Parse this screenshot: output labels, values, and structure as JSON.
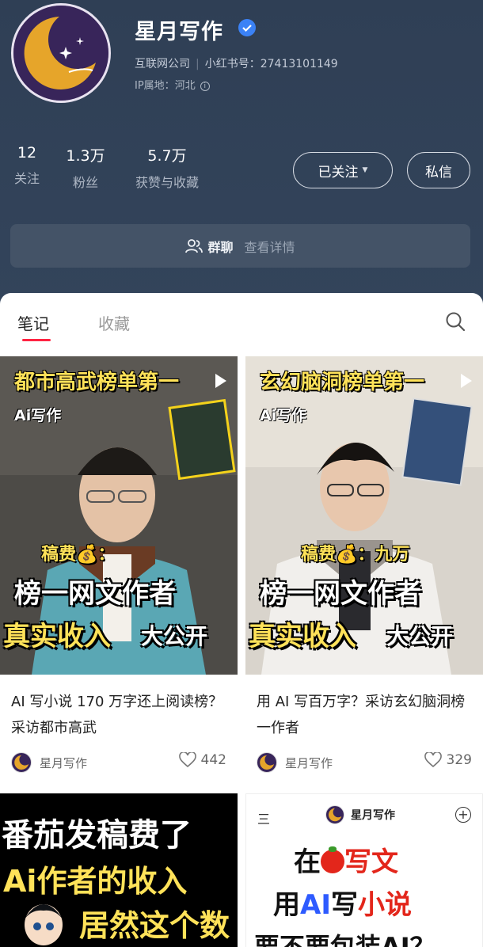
{
  "profile": {
    "name": "星月写作",
    "category": "互联网公司",
    "id_label": "小红书号：",
    "id_value": "27413101149",
    "ip_label": "IP属地：",
    "ip_value": "河北"
  },
  "stats": [
    {
      "value": "12",
      "label": "关注"
    },
    {
      "value": "1.3万",
      "label": "粉丝"
    },
    {
      "value": "5.7万",
      "label": "获赞与收藏"
    }
  ],
  "buttons": {
    "follow": "已关注",
    "message": "私信"
  },
  "group": {
    "title": "群聊",
    "detail": "查看详情"
  },
  "tabs": [
    "笔记",
    "收藏"
  ],
  "notes": [
    {
      "cover_title": "都市高武榜单第一",
      "cover_tag": "Ai写作",
      "cover_fee": "稿费💰：",
      "cover_line1": "榜一网文作者",
      "cover_line2": "真实收入",
      "cover_line3": "大公开",
      "title": "AI 写小说 170 万字还上阅读榜？采访都市高武",
      "author": "星月写作",
      "likes": "442"
    },
    {
      "cover_title": "玄幻脑洞榜单第一",
      "cover_tag": "Ai写作",
      "cover_fee": "稿费💰：九万",
      "cover_line1": "榜一网文作者",
      "cover_line2": "真实收入",
      "cover_line3": "大公开",
      "title": "用 AI 写百万字？采访玄幻脑洞榜一作者",
      "author": "星月写作",
      "likes": "329"
    },
    {
      "cover_line1": "番茄发稿费了",
      "cover_line2": "Ai作者的收入",
      "cover_line3": "居然这个数"
    },
    {
      "cover_menu": "三",
      "cover_brand": "星月写作",
      "cover_plus": "+",
      "cover_line1_a": "在",
      "cover_line1_b": "写文",
      "cover_line2_a": "用",
      "cover_line2_b": "AI",
      "cover_line2_c": "写",
      "cover_line2_d": "小说",
      "cover_line3": "要不要包装AI？"
    }
  ],
  "colors": {
    "header_bg": "#2f3f55",
    "accent_red": "#ff2442",
    "cover_yellow": "#ffe259",
    "verified_blue": "#3b82f6"
  }
}
